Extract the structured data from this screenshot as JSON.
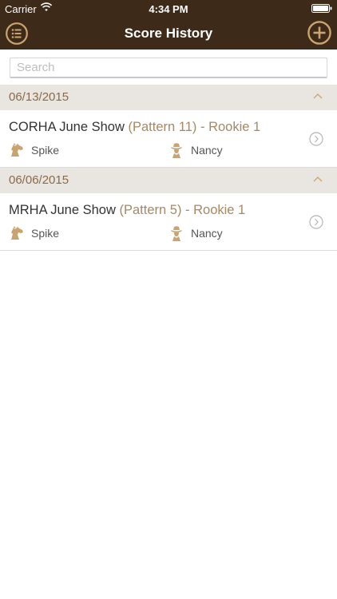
{
  "status": {
    "carrier": "Carrier",
    "time": "4:34 PM"
  },
  "nav": {
    "title": "Score History",
    "left_icon": "list-icon",
    "right_icon": "add-circle-icon"
  },
  "search": {
    "placeholder": "Search",
    "value": ""
  },
  "sections": [
    {
      "date": "06/13/2015",
      "rows": [
        {
          "show": "CORHA June Show",
          "detail": "(Pattern 11) - Rookie 1",
          "horse": "Spike",
          "rider": "Nancy"
        }
      ]
    },
    {
      "date": "06/06/2015",
      "rows": [
        {
          "show": "MRHA June Show",
          "detail": "(Pattern 5) - Rookie 1",
          "horse": "Spike",
          "rider": "Nancy"
        }
      ]
    }
  ],
  "colors": {
    "header_bg": "#3e2a18",
    "accent": "#c9a46f",
    "section_bg": "#e9e6e1",
    "detail_text": "#a78864"
  }
}
